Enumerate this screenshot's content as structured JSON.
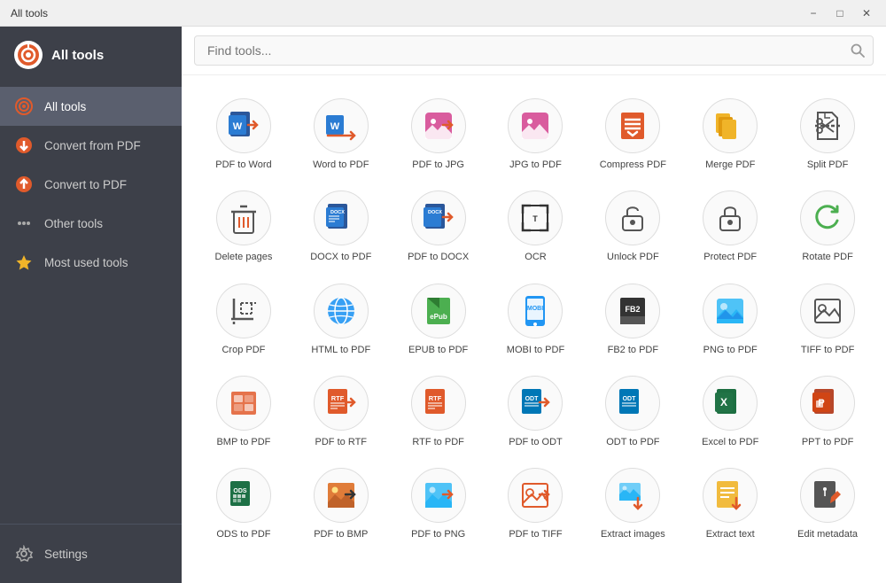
{
  "titleBar": {
    "title": "All tools",
    "minimizeLabel": "−",
    "maximizeLabel": "□",
    "closeLabel": "✕"
  },
  "sidebar": {
    "appName": "All tools",
    "items": [
      {
        "id": "all-tools",
        "label": "All tools",
        "active": true
      },
      {
        "id": "convert-from-pdf",
        "label": "Convert from PDF",
        "active": false
      },
      {
        "id": "convert-to-pdf",
        "label": "Convert to PDF",
        "active": false
      },
      {
        "id": "other-tools",
        "label": "Other tools",
        "active": false
      },
      {
        "id": "most-used-tools",
        "label": "Most used tools",
        "active": false
      }
    ],
    "footer": [
      {
        "id": "settings",
        "label": "Settings"
      }
    ]
  },
  "search": {
    "placeholder": "Find tools..."
  },
  "tools": [
    {
      "id": "pdf-to-word",
      "label": "PDF to Word",
      "iconType": "pdf-to-word"
    },
    {
      "id": "word-to-pdf",
      "label": "Word to PDF",
      "iconType": "word-to-pdf"
    },
    {
      "id": "pdf-to-jpg",
      "label": "PDF to JPG",
      "iconType": "pdf-to-jpg"
    },
    {
      "id": "jpg-to-pdf",
      "label": "JPG to PDF",
      "iconType": "jpg-to-pdf"
    },
    {
      "id": "compress-pdf",
      "label": "Compress PDF",
      "iconType": "compress-pdf"
    },
    {
      "id": "merge-pdf",
      "label": "Merge PDF",
      "iconType": "merge-pdf"
    },
    {
      "id": "split-pdf",
      "label": "Split PDF",
      "iconType": "split-pdf"
    },
    {
      "id": "delete-pages",
      "label": "Delete pages",
      "iconType": "delete-pages"
    },
    {
      "id": "docx-to-pdf",
      "label": "DOCX to PDF",
      "iconType": "docx-to-pdf"
    },
    {
      "id": "pdf-to-docx",
      "label": "PDF to DOCX",
      "iconType": "pdf-to-docx"
    },
    {
      "id": "ocr",
      "label": "OCR",
      "iconType": "ocr"
    },
    {
      "id": "unlock-pdf",
      "label": "Unlock PDF",
      "iconType": "unlock-pdf"
    },
    {
      "id": "protect-pdf",
      "label": "Protect PDF",
      "iconType": "protect-pdf"
    },
    {
      "id": "rotate-pdf",
      "label": "Rotate PDF",
      "iconType": "rotate-pdf"
    },
    {
      "id": "crop-pdf",
      "label": "Crop PDF",
      "iconType": "crop-pdf"
    },
    {
      "id": "html-to-pdf",
      "label": "HTML to PDF",
      "iconType": "html-to-pdf"
    },
    {
      "id": "epub-to-pdf",
      "label": "EPUB to PDF",
      "iconType": "epub-to-pdf"
    },
    {
      "id": "mobi-to-pdf",
      "label": "MOBI to PDF",
      "iconType": "mobi-to-pdf"
    },
    {
      "id": "fb2-to-pdf",
      "label": "FB2 to PDF",
      "iconType": "fb2-to-pdf"
    },
    {
      "id": "png-to-pdf",
      "label": "PNG to PDF",
      "iconType": "png-to-pdf"
    },
    {
      "id": "tiff-to-pdf",
      "label": "TIFF to PDF",
      "iconType": "tiff-to-pdf"
    },
    {
      "id": "bmp-to-pdf",
      "label": "BMP to PDF",
      "iconType": "bmp-to-pdf"
    },
    {
      "id": "pdf-to-rtf",
      "label": "PDF to RTF",
      "iconType": "pdf-to-rtf"
    },
    {
      "id": "rtf-to-pdf",
      "label": "RTF to PDF",
      "iconType": "rtf-to-pdf"
    },
    {
      "id": "pdf-to-odt",
      "label": "PDF to ODT",
      "iconType": "pdf-to-odt"
    },
    {
      "id": "odt-to-pdf",
      "label": "ODT to PDF",
      "iconType": "odt-to-pdf"
    },
    {
      "id": "excel-to-pdf",
      "label": "Excel to PDF",
      "iconType": "excel-to-pdf"
    },
    {
      "id": "ppt-to-pdf",
      "label": "PPT to PDF",
      "iconType": "ppt-to-pdf"
    },
    {
      "id": "ods-to-pdf",
      "label": "ODS to PDF",
      "iconType": "ods-to-pdf"
    },
    {
      "id": "pdf-to-bmp",
      "label": "PDF to BMP",
      "iconType": "pdf-to-bmp"
    },
    {
      "id": "pdf-to-png",
      "label": "PDF to PNG",
      "iconType": "pdf-to-png"
    },
    {
      "id": "pdf-to-tiff",
      "label": "PDF to TIFF",
      "iconType": "pdf-to-tiff"
    },
    {
      "id": "extract-images",
      "label": "Extract images",
      "iconType": "extract-images"
    },
    {
      "id": "extract-text",
      "label": "Extract text",
      "iconType": "extract-text"
    },
    {
      "id": "edit-metadata",
      "label": "Edit metadata",
      "iconType": "edit-metadata"
    }
  ]
}
